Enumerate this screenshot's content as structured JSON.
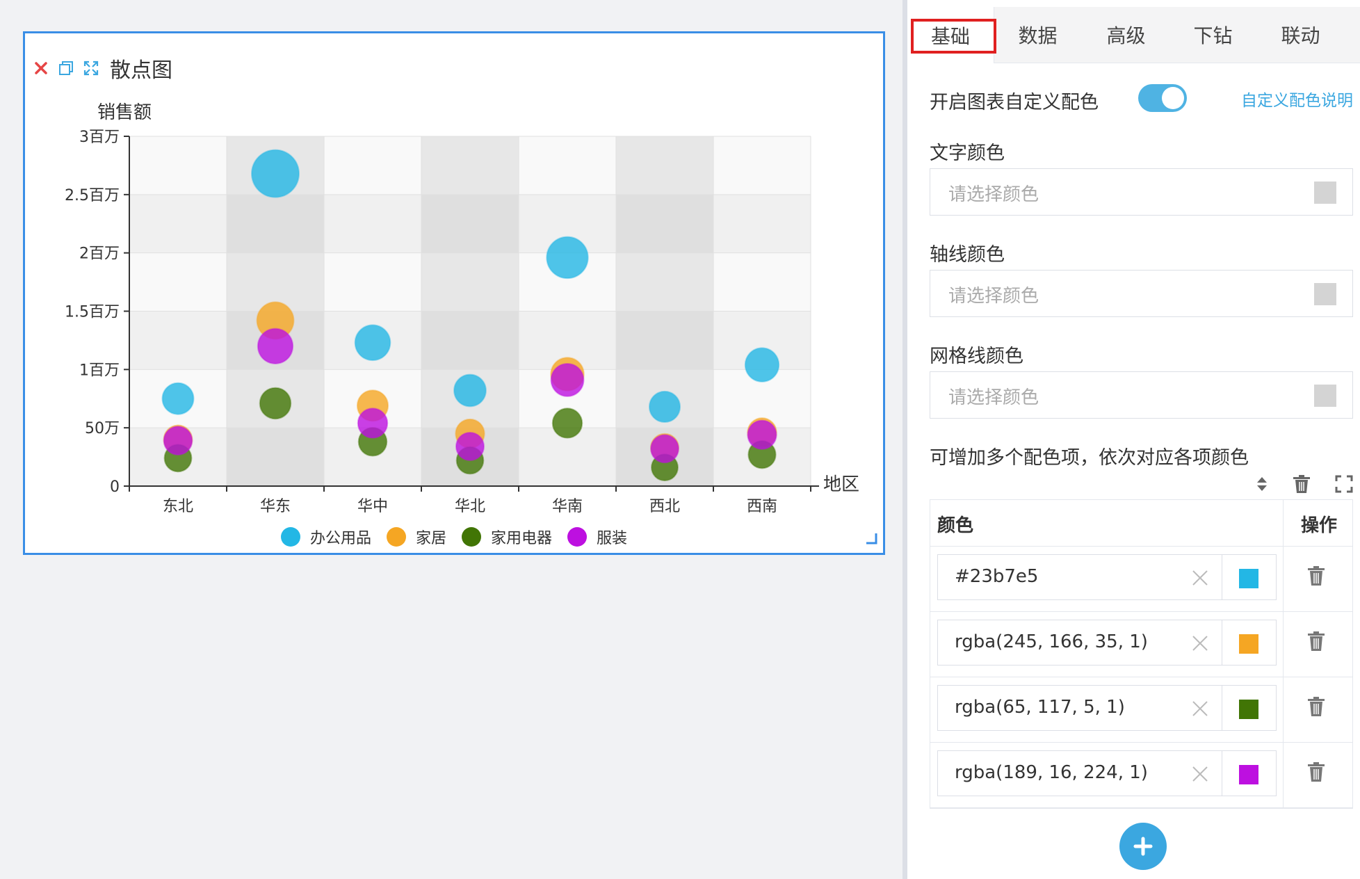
{
  "widget": {
    "title": "散点图",
    "icons": [
      "close-icon",
      "copy-icon",
      "fullscreen-icon"
    ]
  },
  "chart_data": {
    "type": "scatter",
    "ylabel": "销售额",
    "xlabel": "地区",
    "categories": [
      "东北",
      "华东",
      "华中",
      "华北",
      "华南",
      "西北",
      "西南"
    ],
    "yticks": [
      "0",
      "50万",
      "1百万",
      "1.5百万",
      "2百万",
      "2.5百万",
      "3百万"
    ],
    "ylim": [
      0,
      3000000
    ],
    "legend_position": "bottom",
    "series": [
      {
        "name": "办公用品",
        "color": "#23b7e5",
        "values": [
          750000,
          2680000,
          1230000,
          820000,
          1960000,
          680000,
          1040000
        ]
      },
      {
        "name": "家居",
        "color": "#f5a623",
        "values": [
          400000,
          1420000,
          690000,
          450000,
          960000,
          330000,
          460000
        ]
      },
      {
        "name": "家用电器",
        "color": "#417505",
        "values": [
          240000,
          710000,
          380000,
          220000,
          540000,
          160000,
          270000
        ]
      },
      {
        "name": "服装",
        "color": "#bd10e0",
        "values": [
          390000,
          1200000,
          540000,
          340000,
          910000,
          320000,
          440000
        ]
      }
    ]
  },
  "panel": {
    "tabs": [
      "基础",
      "数据",
      "高级",
      "下钻",
      "联动"
    ],
    "active_tab": "基础",
    "custom_color_label": "开启图表自定义配色",
    "custom_color_enabled": true,
    "custom_color_help": "自定义配色说明",
    "text_color_label": "文字颜色",
    "axis_color_label": "轴线颜色",
    "grid_color_label": "网格线颜色",
    "color_placeholder": "请选择颜色",
    "multi_color_hint": "可增加多个配色项，依次对应各项颜色",
    "table": {
      "col_color": "颜色",
      "col_op": "操作",
      "rows": [
        {
          "value": "#23b7e5",
          "swatch": "#23b7e5"
        },
        {
          "value": "rgba(245, 166, 35, 1)",
          "swatch": "#f5a623"
        },
        {
          "value": "rgba(65, 117, 5, 1)",
          "swatch": "#417505"
        },
        {
          "value": "rgba(189, 16, 224, 1)",
          "swatch": "#bd10e0"
        }
      ]
    }
  }
}
